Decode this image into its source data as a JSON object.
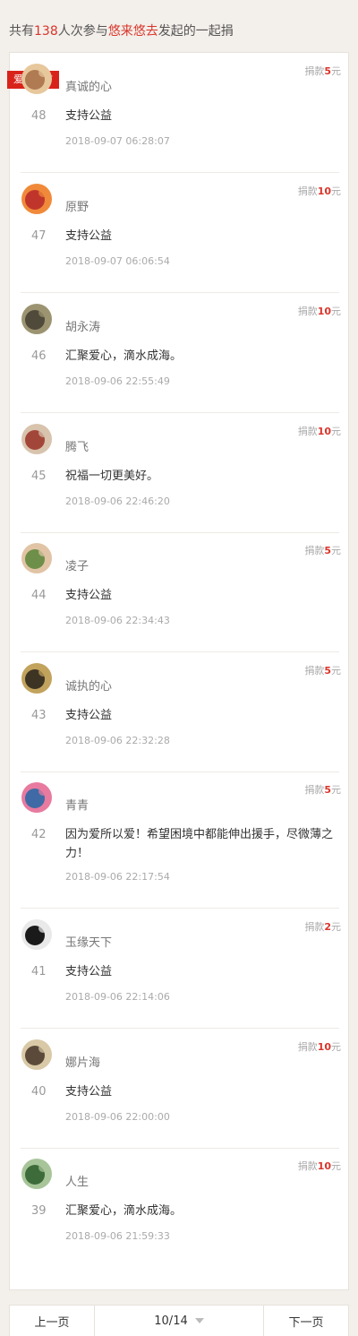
{
  "summary": {
    "prefix": "共有",
    "count": "138",
    "middle": "人次参与",
    "initiator": "悠来悠去",
    "suffix": "发起的一起捐"
  },
  "tag_label": "爱心留言",
  "amount_label": "捐款",
  "currency_unit": "元",
  "entries": [
    {
      "name": "真诚的心",
      "amount": "5",
      "index": "48",
      "message": "支持公益",
      "time": "2018-09-07 06:28:07",
      "avatar_colors": [
        "#b07a52",
        "#e7c79c"
      ]
    },
    {
      "name": "原野",
      "amount": "10",
      "index": "47",
      "message": "支持公益",
      "time": "2018-09-07 06:06:54",
      "avatar_colors": [
        "#c0352b",
        "#f08a3a"
      ]
    },
    {
      "name": "胡永涛",
      "amount": "10",
      "index": "46",
      "message": "汇聚爱心，滴水成海。",
      "time": "2018-09-06 22:55:49",
      "avatar_colors": [
        "#4f4a3a",
        "#9c9471"
      ]
    },
    {
      "name": "腾飞",
      "amount": "10",
      "index": "45",
      "message": "祝福一切更美好。",
      "time": "2018-09-06 22:46:20",
      "avatar_colors": [
        "#a3463a",
        "#d8c3ad"
      ]
    },
    {
      "name": "凌子",
      "amount": "5",
      "index": "44",
      "message": "支持公益",
      "time": "2018-09-06 22:34:43",
      "avatar_colors": [
        "#6d8f49",
        "#e1c4a5"
      ]
    },
    {
      "name": "诚执的心",
      "amount": "5",
      "index": "43",
      "message": "支持公益",
      "time": "2018-09-06 22:32:28",
      "avatar_colors": [
        "#3d3424",
        "#c2a35d"
      ]
    },
    {
      "name": "青青",
      "amount": "5",
      "index": "42",
      "message": "因为爱所以爱！希望困境中都能伸出援手，尽微薄之力！",
      "time": "2018-09-06 22:17:54",
      "avatar_colors": [
        "#3f6aa5",
        "#e87aa0"
      ]
    },
    {
      "name": "玉缘天下",
      "amount": "2",
      "index": "41",
      "message": "支持公益",
      "time": "2018-09-06 22:14:06",
      "avatar_colors": [
        "#1a1a1a",
        "#e9e9e9"
      ]
    },
    {
      "name": "娜片海",
      "amount": "10",
      "index": "40",
      "message": "支持公益",
      "time": "2018-09-06 22:00:00",
      "avatar_colors": [
        "#5b4a3a",
        "#d9c9a6"
      ]
    },
    {
      "name": "人生",
      "amount": "10",
      "index": "39",
      "message": "汇聚爱心，滴水成海。",
      "time": "2018-09-06 21:59:33",
      "avatar_colors": [
        "#3d6b3a",
        "#a8c59a"
      ]
    }
  ],
  "pagination": {
    "prev_label": "上一页",
    "current": "10/14",
    "next_label": "下一页"
  }
}
